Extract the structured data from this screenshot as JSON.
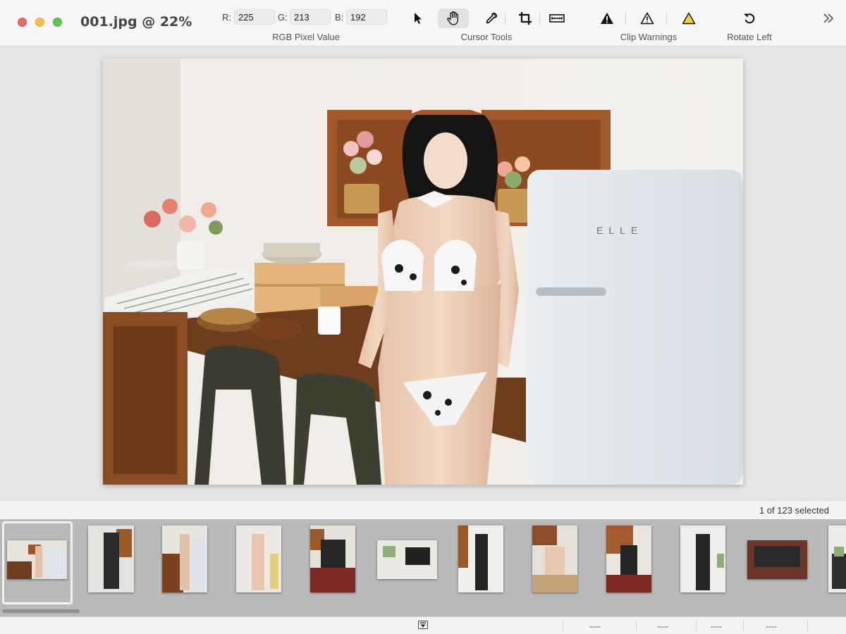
{
  "window": {
    "title": "001.jpg @ 22%"
  },
  "toolbar": {
    "rgb": {
      "r_label": "R:",
      "r_value": "225",
      "g_label": "G:",
      "g_value": "213",
      "b_label": "B:",
      "b_value": "192",
      "group_label": "RGB Pixel Value"
    },
    "cursor_tools": {
      "group_label": "Cursor Tools",
      "tools": [
        "arrow-icon",
        "hand-icon",
        "eyedropper-icon",
        "crop-icon",
        "ruler-icon"
      ],
      "active": "hand-icon"
    },
    "clip_warnings": {
      "group_label": "Clip Warnings",
      "icons": [
        "warning-black-icon",
        "warning-outline-icon",
        "warning-yellow-icon"
      ]
    },
    "rotate": {
      "label": "Rotate Left"
    },
    "overflow_icon": "chevron-double-right-icon"
  },
  "filmstrip": {
    "selection_status": "1 of 123 selected",
    "thumbnail_count_visible": 12,
    "selected_index": 0
  },
  "bottombar": {
    "fields": [
      "----",
      "----",
      "----",
      "----"
    ]
  },
  "colors": {
    "toolbar_bg": "#f6f6f6",
    "filmstrip_bg": "#b9b9b9",
    "selection_border": "#f2f2f2"
  }
}
